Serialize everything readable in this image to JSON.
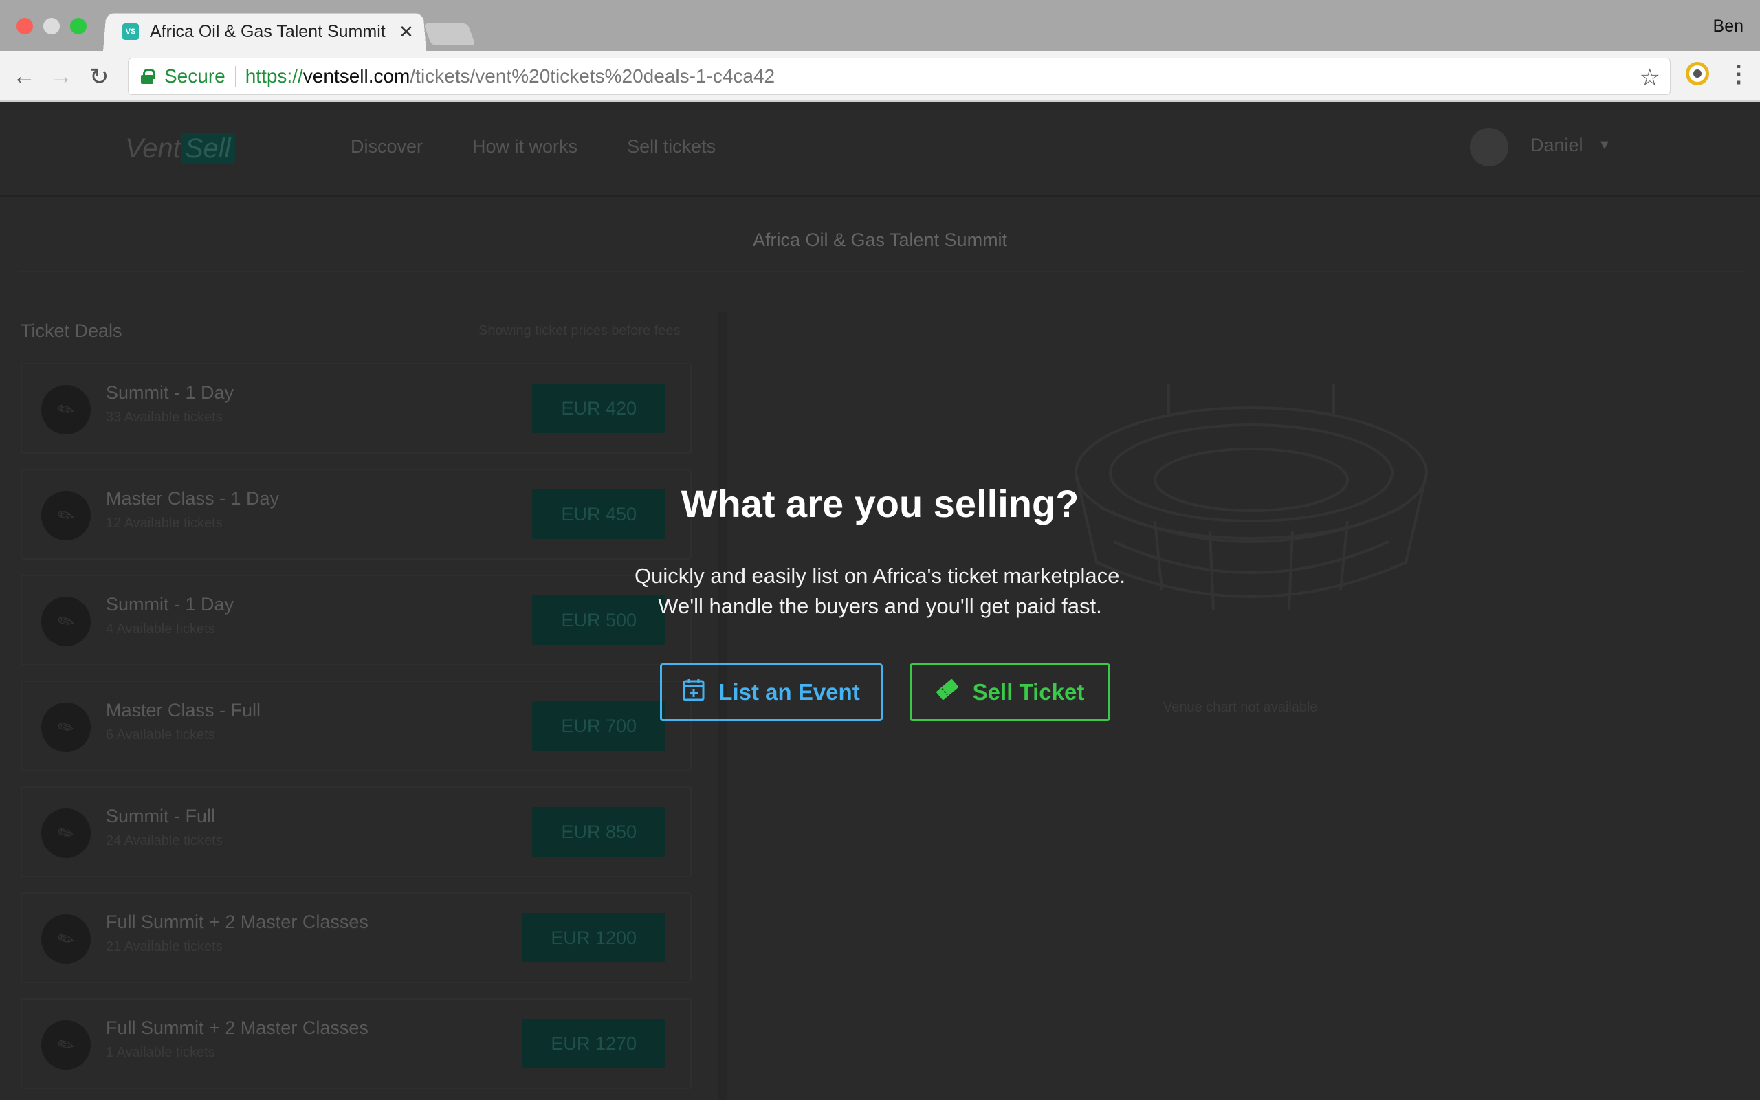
{
  "browser": {
    "tab_title": "Africa Oil & Gas Talent Summit",
    "tab_favicon": "VS",
    "profile_name": "Ben",
    "secure_label": "Secure",
    "url_scheme": "https://",
    "url_host": "ventsell.com",
    "url_path": "/tickets/vent%20tickets%20deals-1-c4ca42"
  },
  "site": {
    "logo_vent": "Vent",
    "logo_sell": "Sell",
    "nav": [
      "Discover",
      "How it works",
      "Sell tickets"
    ],
    "user_name": "Daniel"
  },
  "event": {
    "title": "Africa Oil & Gas Talent Summit"
  },
  "deals": {
    "heading": "Ticket Deals",
    "note": "Showing ticket prices before fees",
    "items": [
      {
        "name": "Summit - 1 Day",
        "available": "33 Available tickets",
        "price": "EUR 420"
      },
      {
        "name": "Master Class - 1 Day",
        "available": "12 Available tickets",
        "price": "EUR 450"
      },
      {
        "name": "Summit - 1 Day",
        "available": "4 Available tickets",
        "price": "EUR 500"
      },
      {
        "name": "Master Class - Full",
        "available": "6 Available tickets",
        "price": "EUR 700"
      },
      {
        "name": "Summit - Full",
        "available": "24 Available tickets",
        "price": "EUR 850"
      },
      {
        "name": "Full Summit + 2 Master Classes",
        "available": "21 Available tickets",
        "price": "EUR 1200"
      },
      {
        "name": "Full Summit + 2 Master Classes",
        "available": "1 Available tickets",
        "price": "EUR 1270"
      }
    ]
  },
  "venue": {
    "note": "Venue chart not available"
  },
  "modal": {
    "title": "What are you selling?",
    "subtitle_line1": "Quickly and easily list on Africa's ticket marketplace.",
    "subtitle_line2": "We'll handle the buyers and you'll get paid fast.",
    "list_event_label": "List an Event",
    "sell_ticket_label": "Sell Ticket"
  },
  "colors": {
    "accent_blue": "#45b3f2",
    "accent_green": "#3ac949",
    "price_button": "#0b2f2b"
  },
  "icons": {
    "list_event": "calendar-plus-icon",
    "sell_ticket": "ticket-icon",
    "deal": "ticket-icon",
    "venue": "stadium-icon"
  }
}
